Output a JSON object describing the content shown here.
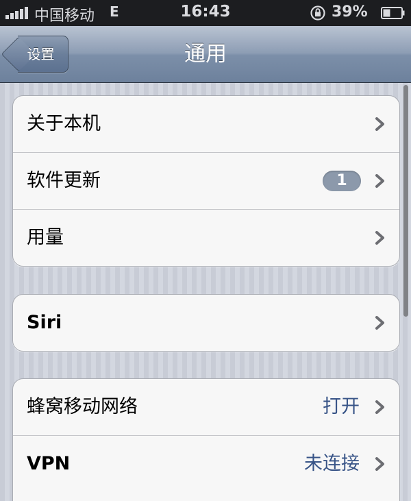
{
  "status_bar": {
    "carrier": "中国移动",
    "network": "E",
    "time": "16:43",
    "battery": "39%",
    "icons": [
      "signal-icon",
      "rotation-lock-icon",
      "battery-icon"
    ]
  },
  "nav": {
    "back_label": "设置",
    "title": "通用"
  },
  "groups": [
    {
      "rows": [
        {
          "label": "关于本机"
        },
        {
          "label": "软件更新",
          "badge": "1"
        },
        {
          "label": "用量"
        }
      ]
    },
    {
      "rows": [
        {
          "label": "Siri"
        }
      ]
    },
    {
      "rows": [
        {
          "label": "蜂窝移动网络",
          "value": "打开"
        },
        {
          "label": "VPN",
          "value": "未连接"
        }
      ]
    }
  ],
  "colors": {
    "value_text": "#385487",
    "badge": "#8c99ab",
    "nav_bar": "#7c8fa9"
  }
}
